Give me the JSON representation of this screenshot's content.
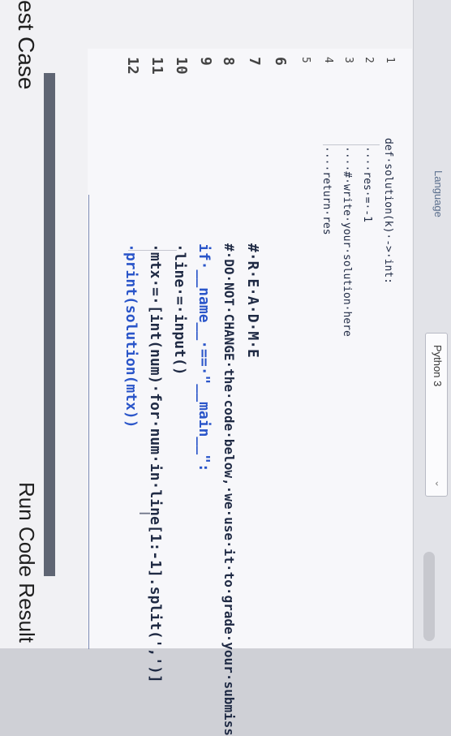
{
  "header": {
    "language_label": "Language",
    "language_value": "Python 3",
    "chevron": "chevron-down-icon"
  },
  "editor": {
    "line_numbers": [
      "1",
      "2",
      "3",
      "4",
      "5",
      "6",
      "7",
      "8",
      "9",
      "10",
      "11",
      "12"
    ],
    "lines": {
      "l1": "def·solution(k)·->·int:",
      "l2": "····res·=·-1",
      "l3": "····#·write·your·solution·here",
      "l4": "····return·res",
      "l5": "",
      "l6": "",
      "l7": "#·R·E·A·D·M·E",
      "l8": "#·DO·NOT·CHANGE·the·code·below,·we·use·it·to·grade·your·submiss",
      "l9": "if·__name__·==·\"__main__\":",
      "l10": "·line·=·input()",
      "l11": "·mtx·=·[int(num)·for·num·in·line[1:-1].split(',')]",
      "l12": "·print(solution(mtx))"
    }
  },
  "footer": {
    "test_case_label": "est Case",
    "run_result_label": "Run Code Result"
  },
  "colors": {
    "keyword": "#2a55c9",
    "text": "#1f2a44",
    "accent": "#5f6573"
  }
}
